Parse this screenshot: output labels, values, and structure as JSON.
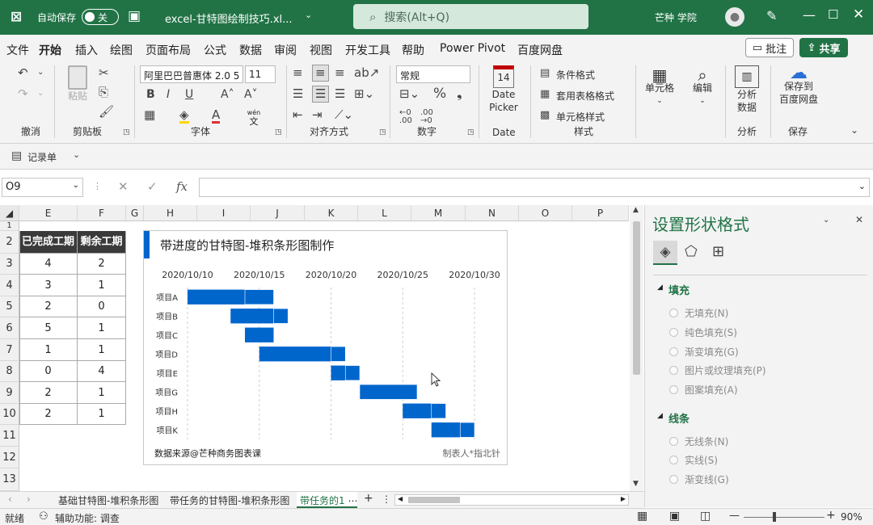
{
  "titlebar": {
    "autosave_label": "自动保存",
    "autosave_state": "关",
    "filename": "excel-甘特图绘制技巧.xl...",
    "search_placeholder": "搜索(Alt+Q)",
    "user_name": "芒种 学院"
  },
  "tabs": [
    "文件",
    "开始",
    "插入",
    "绘图",
    "页面布局",
    "公式",
    "数据",
    "审阅",
    "视图",
    "开发工具",
    "帮助",
    "Power Pivot",
    "百度网盘"
  ],
  "active_tab": "开始",
  "buttons": {
    "comment": "批注",
    "share": "共享"
  },
  "ribbon": {
    "undo_group": "撤消",
    "clipboard_group": "剪贴板",
    "paste_label": "粘贴",
    "font_name": "阿里巴巴普惠体 2.0 5",
    "font_size": "11",
    "font_group": "字体",
    "wen_label": "wén",
    "align_group": "对齐方式",
    "number_format": "常规",
    "number_group": "数字",
    "date_picker_line1": "Date",
    "date_picker_line2": "Picker",
    "date_group": "Date",
    "calendar_num": "14",
    "cond_format": "条件格式",
    "table_format": "套用表格格式",
    "cell_style": "单元格样式",
    "style_group": "样式",
    "cells_label": "单元格",
    "edit_label": "编辑",
    "analyze_line1": "分析",
    "analyze_line2": "数据",
    "analyze_group": "分析",
    "save_baidu_line1": "保存到",
    "save_baidu_line2": "百度网盘",
    "save_group": "保存"
  },
  "qat": {
    "record_form": "记录单"
  },
  "formula_bar": {
    "name_box": "O9",
    "fx": "fx"
  },
  "columns": [
    "E",
    "F",
    "G",
    "H",
    "I",
    "J",
    "K",
    "L",
    "M",
    "N",
    "O",
    "P"
  ],
  "rows": [
    "1",
    "2",
    "3",
    "4",
    "5",
    "6",
    "7",
    "8",
    "9",
    "10",
    "11",
    "12",
    "13"
  ],
  "table": {
    "headers": [
      "已完成工期",
      "剩余工期"
    ],
    "rows": [
      [
        "4",
        "2"
      ],
      [
        "3",
        "1"
      ],
      [
        "2",
        "0"
      ],
      [
        "5",
        "1"
      ],
      [
        "1",
        "1"
      ],
      [
        "0",
        "4"
      ],
      [
        "2",
        "1"
      ],
      [
        "2",
        "1"
      ]
    ]
  },
  "chart_data": {
    "type": "bar",
    "orientation": "horizontal-stacked",
    "title": "带进度的甘特图-堆积条形图制作",
    "x_tick_labels": [
      "2020/10/10",
      "2020/10/15",
      "2020/10/20",
      "2020/10/25",
      "2020/10/30"
    ],
    "xlim": [
      "2020/10/10",
      "2020/10/30"
    ],
    "categories": [
      "项目A",
      "项目B",
      "项目C",
      "项目D",
      "项目E",
      "项目G",
      "项目H",
      "项目K"
    ],
    "start": [
      "2020/10/10",
      "2020/10/13",
      "2020/10/14",
      "2020/10/15",
      "2020/10/20",
      "2020/10/22",
      "2020/10/25",
      "2020/10/27"
    ],
    "series": [
      {
        "values": [
          4,
          3,
          2,
          5,
          1,
          0,
          2,
          2
        ]
      },
      {
        "values": [
          2,
          1,
          0,
          1,
          1,
          4,
          1,
          1
        ]
      }
    ],
    "bar_color": "#0066cc",
    "source_note": "数据来源@芒种商务图表课",
    "author_note": "制表人*指北针"
  },
  "pane": {
    "title": "设置形状格式",
    "fill_section": "填充",
    "fill_options": [
      "无填充(N)",
      "纯色填充(S)",
      "渐变填充(G)",
      "图片或纹理填充(P)",
      "图案填充(A)"
    ],
    "line_section": "线条",
    "line_options": [
      "无线条(N)",
      "实线(S)",
      "渐变线(G)"
    ]
  },
  "sheet_tabs": [
    "基础甘特图-堆积条形图",
    "带任务的甘特图-堆积条形图",
    "带任务的1"
  ],
  "status": {
    "ready": "就绪",
    "accessibility": "辅助功能: 调查",
    "zoom": "90%"
  },
  "colors": {
    "brand": "#217346",
    "bar": "#0066cc"
  }
}
